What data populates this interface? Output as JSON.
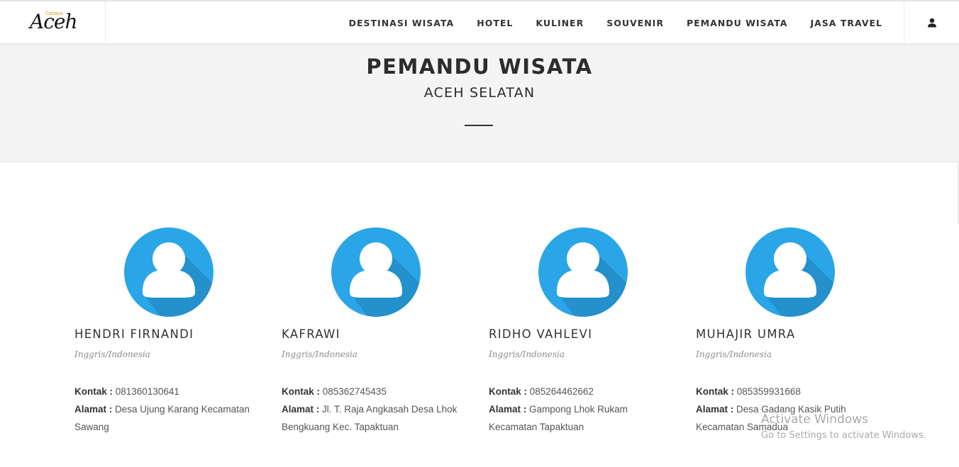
{
  "header": {
    "logo_text": "Aceh",
    "logo_small": "Cahaya",
    "nav": [
      "DESTINASI WISATA",
      "HOTEL",
      "KULINER",
      "SOUVENIR",
      "PEMANDU WISATA",
      "JASA TRAVEL"
    ],
    "user_icon": "user-icon"
  },
  "hero": {
    "title": "PEMANDU WISATA",
    "subtitle": "ACEH SELATAN"
  },
  "guides": [
    {
      "name": "HENDRI FIRNANDI",
      "language": "Inggris/Indonesia",
      "contact_label": "Kontak :",
      "contact": "081360130641",
      "address_label": "Alamat :",
      "address": "Desa Ujung Karang Kecamatan Sawang"
    },
    {
      "name": "KAFRAWI",
      "language": "Inggris/Indonesia",
      "contact_label": "Kontak :",
      "contact": "085362745435",
      "address_label": "Alamat :",
      "address": "Jl. T. Raja Angkasah Desa Lhok Bengkuang Kec. Tapaktuan"
    },
    {
      "name": "RIDHO VAHLEVI",
      "language": "Inggris/Indonesia",
      "contact_label": "Kontak :",
      "contact": "085264462662",
      "address_label": "Alamat :",
      "address": "Gampong Lhok Rukam Kecamatan Tapaktuan"
    },
    {
      "name": "MUHAJIR UMRA",
      "language": "Inggris/Indonesia",
      "contact_label": "Kontak :",
      "contact": "085359931668",
      "address_label": "Alamat :",
      "address": "Desa Gadang Kasik Putih Kecamatan Samadua"
    }
  ],
  "watermark": {
    "line1": "Activate Windows",
    "line2": "Go to Settings to activate Windows."
  },
  "colors": {
    "avatar_blue": "#2aa6e8",
    "avatar_shadow": "#2490cc",
    "hero_bg": "#f4f4f4"
  }
}
